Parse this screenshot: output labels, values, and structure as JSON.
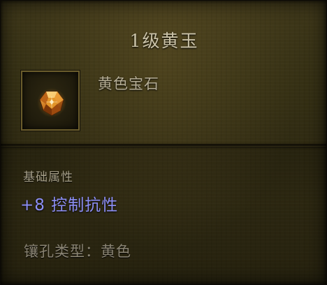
{
  "tooltip": {
    "title": "1级黄玉",
    "item_type": "黄色宝石",
    "icon": "topaz-gem-icon",
    "basic_attributes_heading": "基础属性",
    "attribute": {
      "value": "+8",
      "name": "控制抗性"
    },
    "socket_type_label": "镶孔类型：",
    "socket_type_value": "黄色"
  },
  "colors": {
    "title": "#cbc3a8",
    "attribute": "#8d8ff6",
    "heading": "#a49d86",
    "socket": "#8a8473",
    "gem": "#d98a1e"
  }
}
